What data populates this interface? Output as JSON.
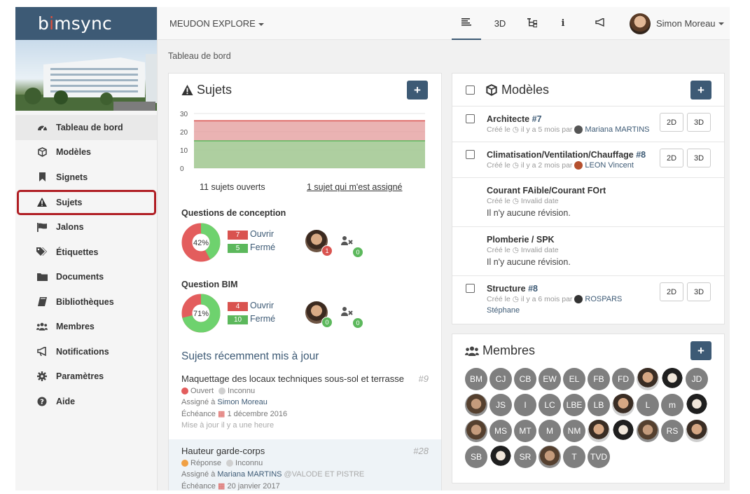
{
  "app": {
    "logo": "bimsync"
  },
  "header": {
    "project": "MEUDON EXPLORE",
    "buttons": [
      "3D",
      "i"
    ],
    "user": "Simon Moreau"
  },
  "sidebar": {
    "items": [
      {
        "label": "Tableau de bord",
        "icon": "dashboard-icon"
      },
      {
        "label": "Modèles",
        "icon": "cube-icon"
      },
      {
        "label": "Signets",
        "icon": "bookmark-icon"
      },
      {
        "label": "Sujets",
        "icon": "warning-icon"
      },
      {
        "label": "Jalons",
        "icon": "flag-icon"
      },
      {
        "label": "Étiquettes",
        "icon": "tags-icon"
      },
      {
        "label": "Documents",
        "icon": "folder-icon"
      },
      {
        "label": "Bibliothèques",
        "icon": "book-icon"
      },
      {
        "label": "Membres",
        "icon": "users-icon"
      },
      {
        "label": "Notifications",
        "icon": "bullhorn-icon"
      },
      {
        "label": "Paramètres",
        "icon": "gear-icon"
      },
      {
        "label": "Aide",
        "icon": "help-icon"
      }
    ]
  },
  "breadcrumb": "Tableau de bord",
  "sujets": {
    "title": "Sujets",
    "open_link": "11 sujets ouverts",
    "assigned_link": "1 sujet qui m'est assigné",
    "sections": [
      {
        "title": "Questions de conception",
        "percent": "42%",
        "open_count": "7",
        "closed_count": "5",
        "open_label": "Ouvrir",
        "closed_label": "Fermé",
        "user_count": "1",
        "unassigned_count": "0"
      },
      {
        "title": "Question BIM",
        "percent": "71%",
        "open_count": "4",
        "closed_count": "10",
        "open_label": "Ouvrir",
        "closed_label": "Fermé",
        "user_count": "0",
        "unassigned_count": "0"
      }
    ],
    "recent_title": "Sujets récemment mis à jour",
    "recent": [
      {
        "title": "Maquettage des locaux techniques sous-sol et terrasse",
        "num": "#9",
        "status": "Ouvert",
        "priority": "Inconnu",
        "assigned_prefix": "Assigné à",
        "assigned": "Simon Moreau",
        "assigned_company": "",
        "due_prefix": "Échéance",
        "due": "1 décembre 2016",
        "updated": "Mise à jour il y a une heure"
      },
      {
        "title": "Hauteur garde-corps",
        "num": "#28",
        "status": "Réponse",
        "priority": "Inconnu",
        "assigned_prefix": "Assigné à",
        "assigned": "Mariana MARTINS",
        "assigned_company": "@VALODE ET PISTRE",
        "due_prefix": "Échéance",
        "due": "20 janvier 2017",
        "updated": ""
      }
    ],
    "chart_data": {
      "type": "area",
      "yticks": [
        0,
        10,
        20,
        30
      ],
      "ylim": [
        0,
        30
      ],
      "series": [
        {
          "values": [
            26,
            26,
            26,
            26,
            26,
            26,
            26,
            26,
            26,
            26
          ],
          "color": "#e39a9a"
        },
        {
          "values": [
            15,
            15,
            15,
            15,
            15,
            15,
            15,
            15,
            15,
            15
          ],
          "color": "#9ad89a"
        }
      ]
    }
  },
  "modeles": {
    "title": "Modèles",
    "btn_2d": "2D",
    "btn_3d": "3D",
    "created": "Créé le",
    "items": [
      {
        "name": "Architecte",
        "version": "#7",
        "time": "il y a 5 mois par",
        "author": "Mariana MARTINS",
        "has_revision": true
      },
      {
        "name": "Climatisation/Ventilation/Chauffage",
        "version": "#8",
        "time": "il y a 2 mois par",
        "author": "LEON Vincent",
        "has_revision": true
      },
      {
        "name": "Courant FAible/Courant FOrt",
        "version": "",
        "time": "Invalid date",
        "author": "",
        "norev": "Il n'y aucune révision.",
        "has_revision": false
      },
      {
        "name": "Plomberie / SPK",
        "version": "",
        "time": "Invalid date",
        "author": "",
        "norev": "Il n'y aucune révision.",
        "has_revision": false
      },
      {
        "name": "Structure",
        "version": "#8",
        "time": "il y a 6 mois par",
        "author": "ROSPARS",
        "author2": "Stéphane",
        "has_revision": true
      }
    ]
  },
  "membres": {
    "title": "Membres",
    "rows": [
      [
        "BM",
        "CJ",
        "CB",
        "EW",
        "EL",
        "FB",
        "FD",
        "",
        "",
        "JD"
      ],
      [
        "",
        "JS",
        "I",
        "LC",
        "LBE",
        "LB",
        "",
        "L",
        "m",
        ""
      ],
      [
        "",
        "MS",
        "MT",
        "M",
        "NM",
        "",
        "",
        "",
        "RS",
        ""
      ],
      [
        "SB",
        "",
        "SR",
        "",
        "T",
        "TVD"
      ]
    ]
  }
}
